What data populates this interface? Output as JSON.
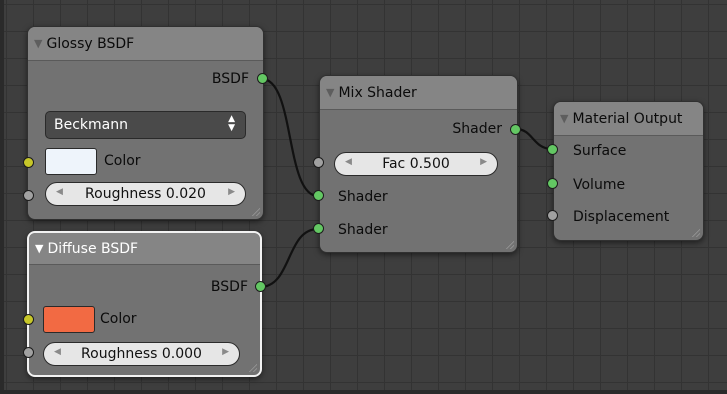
{
  "nodes": {
    "glossy": {
      "title": "Glossy BSDF",
      "output_label": "BSDF",
      "distribution": "Beckmann",
      "color_label": "Color",
      "color_value": "#eef4fb",
      "roughness_label": "Roughness 0.020"
    },
    "diffuse": {
      "title": "Diffuse BSDF",
      "output_label": "BSDF",
      "color_label": "Color",
      "color_value": "#f26a43",
      "roughness_label": "Roughness 0.000"
    },
    "mix": {
      "title": "Mix Shader",
      "output_label": "Shader",
      "fac_label": "Fac 0.500",
      "input1_label": "Shader",
      "input2_label": "Shader"
    },
    "output": {
      "title": "Material Output",
      "surface_label": "Surface",
      "volume_label": "Volume",
      "displacement_label": "Displacement"
    }
  },
  "socket_colors": {
    "shader": "#63c763",
    "color": "#c7c729",
    "value": "#a1a1a1"
  }
}
